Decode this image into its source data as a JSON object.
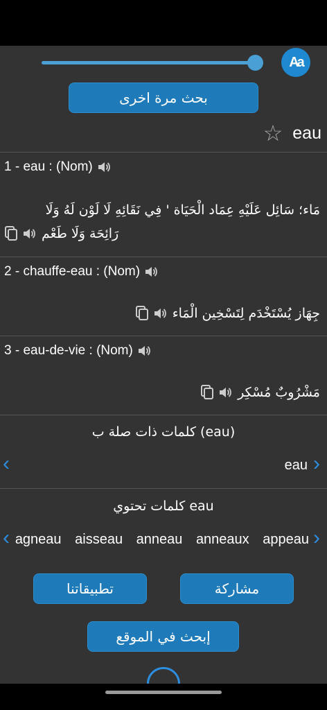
{
  "toolbar": {
    "font_size_button": "Aa",
    "font_size_level": 0.95,
    "search_again_label": "بحث مرة اخرى"
  },
  "word": {
    "title": "eau",
    "favorite_icon": "star-outline-icon"
  },
  "entries": [
    {
      "head": "1 - eau : (Nom)",
      "definition_line1": "مَاء؛ سَائِل عَلَيْهِ عِمَاد الْحَيَاة ' فِي نَقَائِهِ لَا لَوْن لَهُ وَلَا",
      "definition_line2": "رَائِحَة وَلَا طَعْم"
    },
    {
      "head": "2 - chauffe-eau : (Nom)",
      "definition_line1": "جِهَاز يُسْتَخْدَم لِتَسْخِين الْمَاء"
    },
    {
      "head": "3 - eau-de-vie : (Nom)",
      "definition_line1": "مَشْرُوبٌ مُسْكِر"
    }
  ],
  "related": {
    "title": "كلمات ذات صلة ب (eau)",
    "word": "eau"
  },
  "containing": {
    "title": "كلمات تحتوي eau",
    "words": [
      "agneau",
      "aisseau",
      "anneau",
      "anneaux",
      "appeau"
    ]
  },
  "buttons": {
    "share": "مشاركة",
    "our_apps": "تطبيقاتنا",
    "search_site": "إبحث في الموقع"
  },
  "colors": {
    "accent": "#1e7ab8",
    "background": "#333333",
    "arrow": "#2d8ee0"
  }
}
